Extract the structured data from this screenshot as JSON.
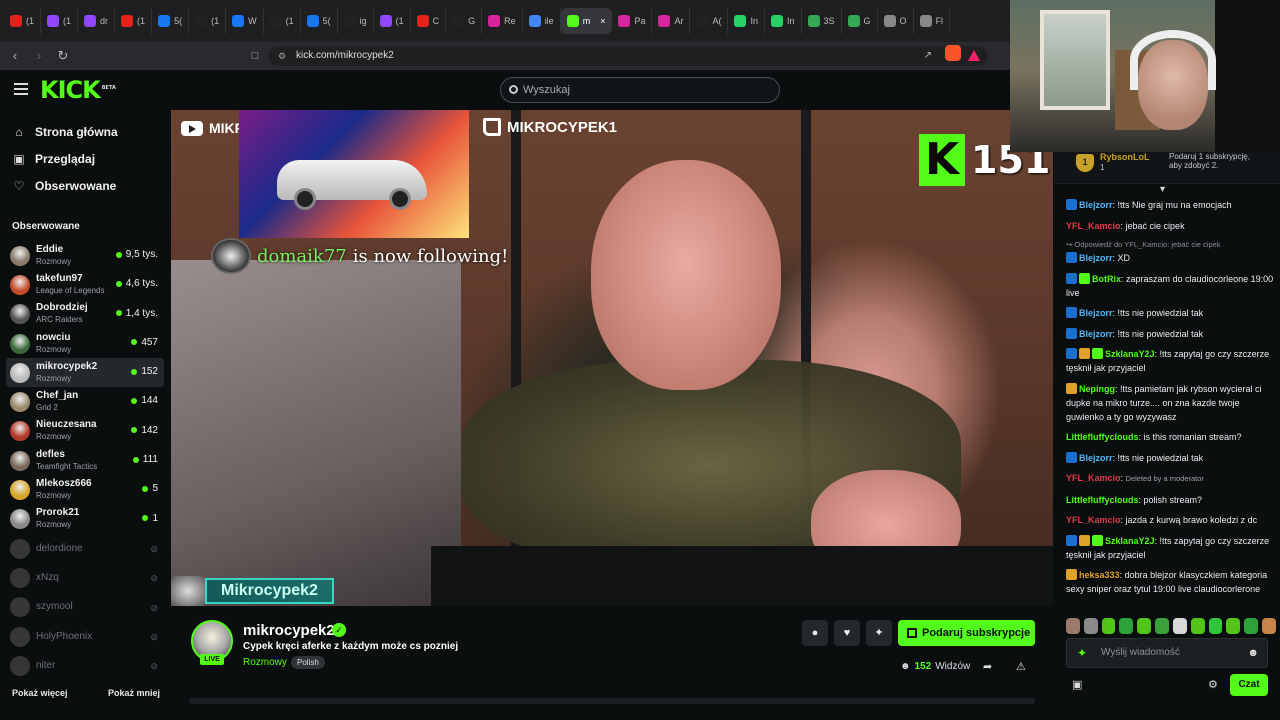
{
  "browser": {
    "tabs": [
      {
        "label": "(1",
        "color": "#e62117"
      },
      {
        "label": "(1",
        "color": "#9146ff"
      },
      {
        "label": "dr",
        "color": "#9146ff"
      },
      {
        "label": "(1",
        "color": "#e62117"
      },
      {
        "label": "5(",
        "color": "#1877f2"
      },
      {
        "label": "(1",
        "color": "#222222"
      },
      {
        "label": "W",
        "color": "#1877f2"
      },
      {
        "label": "(1",
        "color": "#222222"
      },
      {
        "label": "5(",
        "color": "#1877f2"
      },
      {
        "label": "ig",
        "color": "#222222"
      },
      {
        "label": "(1",
        "color": "#9146ff"
      },
      {
        "label": "C",
        "color": "#e62117"
      },
      {
        "label": "G",
        "color": "#222222"
      },
      {
        "label": "Re",
        "color": "#d6249f"
      },
      {
        "label": "ile",
        "color": "#4285f4"
      },
      {
        "label": "m",
        "color": "#53fc18",
        "active": true
      },
      {
        "label": "Pa",
        "color": "#d6249f"
      },
      {
        "label": "Ar",
        "color": "#d6249f"
      },
      {
        "label": "A(",
        "color": "#222222"
      },
      {
        "label": "In",
        "color": "#25d366"
      },
      {
        "label": "In",
        "color": "#25d366"
      },
      {
        "label": "3S",
        "color": "#34a853"
      },
      {
        "label": "G",
        "color": "#34a853"
      },
      {
        "label": "O",
        "color": "#888888"
      },
      {
        "label": "Fl",
        "color": "#888888"
      }
    ],
    "url": "kick.com/mikrocypek2",
    "brave_color": "#fb542b",
    "brave_badge_color": "#ff1f6b"
  },
  "site": {
    "logo": "KICK",
    "logo_sup": "BETA",
    "search_placeholder": "Wyszukaj",
    "accent": "#53fc18"
  },
  "sidebar": {
    "nav": [
      {
        "label": "Strona główna",
        "icon": "home-icon",
        "glyph": "⌂"
      },
      {
        "label": "Przeglądaj",
        "icon": "browse-icon",
        "glyph": "▣"
      },
      {
        "label": "Obserwowane",
        "icon": "heart-icon",
        "glyph": "♡"
      }
    ],
    "following_title": "Obserwowane",
    "channels": [
      {
        "name": "Eddie",
        "category": "Rozmowy",
        "viewers": "9,5 tys.",
        "avatar": "#8a7a6a"
      },
      {
        "name": "takefun97",
        "category": "League of Legends",
        "viewers": "4,6 tys.",
        "avatar": "#c44a2a"
      },
      {
        "name": "Dobrodziej",
        "category": "ARC Raiders",
        "viewers": "1,4 tys.",
        "avatar": "#555555"
      },
      {
        "name": "nowciu",
        "category": "Rozmowy",
        "viewers": "457",
        "avatar": "#3a6a3a"
      },
      {
        "name": "mikrocypek2",
        "category": "Rozmowy",
        "viewers": "152",
        "avatar": "#bbbbbb",
        "selected": true
      },
      {
        "name": "Chef_jan",
        "category": "Grid 2",
        "viewers": "144",
        "avatar": "#9a8a6a"
      },
      {
        "name": "Nieuczesana",
        "category": "Rozmowy",
        "viewers": "142",
        "avatar": "#b03a2a"
      },
      {
        "name": "defles",
        "category": "Teamfight Tactics",
        "viewers": "111",
        "avatar": "#7a6a5a"
      },
      {
        "name": "Mlekosz666",
        "category": "Rozmowy",
        "viewers": "5",
        "avatar": "#d4a52a"
      },
      {
        "name": "Prorok21",
        "category": "Rozmowy",
        "viewers": "1",
        "avatar": "#8a8a8a"
      }
    ],
    "offline": [
      {
        "name": "delordione",
        "avatar": "#777777"
      },
      {
        "name": "xNzq",
        "avatar": "#777777"
      },
      {
        "name": "szymool",
        "avatar": "#777777"
      },
      {
        "name": "HolyPhoenix",
        "avatar": "#777777"
      },
      {
        "name": "niter",
        "avatar": "#777777"
      }
    ],
    "show_more": "Pokaż więcej",
    "show_less": "Pokaż mniej"
  },
  "stream": {
    "yt_label": "MIKR",
    "twitch_label": "MIKROCYPEK1",
    "alert_name": "domaik77",
    "alert_text": "is now following!",
    "counter_value": "151",
    "plate_name": "Mikrocypek2"
  },
  "channel": {
    "name": "mikrocypek2",
    "title": "Cypek kręci aferke z każdym może cs pozniej",
    "category": "Rozmowy",
    "tag": "Polish",
    "live_label": "LIVE",
    "subscribe_label": "Podaruj subskrypcje",
    "viewer_count": "152",
    "viewer_label": "Widzów"
  },
  "chat": {
    "pinned_user": "RybsonLoL",
    "pinned_count": "1",
    "pinned_text": "Podaruj 1 subskrypcję, aby zdobyć 2.",
    "messages": [
      {
        "user": "Blejzorr",
        "color": "#53b6f5",
        "text": "!tts Nie graj mu na emocjach",
        "badges": [
          "#1a6fd0"
        ]
      },
      {
        "user": "YFL_Kamcio",
        "color": "#e0394a",
        "text": "jebać cie cipek",
        "badges": []
      },
      {
        "reply": "Odpowiedź do YFL_Kamcio: jebać cie cipek"
      },
      {
        "user": "Blejzorr",
        "color": "#53b6f5",
        "text": "XD",
        "badges": [
          "#1a6fd0"
        ]
      },
      {
        "user": "BotRix",
        "color": "#53fc18",
        "text": "zapraszam do claudiocorleone 19:00 live",
        "badges": [
          "#1a6fd0",
          "#53fc18"
        ]
      },
      {
        "user": "Blejzorr",
        "color": "#53b6f5",
        "text": "!tts nie powiedzial tak",
        "badges": [
          "#1a6fd0"
        ]
      },
      {
        "user": "Blejzorr",
        "color": "#53b6f5",
        "text": "!tts nie powiedzial tak",
        "badges": [
          "#1a6fd0"
        ]
      },
      {
        "user": "SzklanaY2J",
        "color": "#53fc18",
        "text": "!tts zapytaj go czy szczerze tęsknił jak przyjaciel",
        "badges": [
          "#1a6fd0",
          "#e0a12a",
          "#53fc18"
        ]
      },
      {
        "user": "Nepingg",
        "color": "#53fc18",
        "text": "!tts pamietam jak rybson wycieral ci dupke na mikro turze.... on zna kazde twoje guwienko a ty go wyzywasz",
        "badges": [
          "#e0a12a"
        ]
      },
      {
        "user": "Littlefluffyclouds",
        "color": "#53fc18",
        "text": "is this romanian stream?",
        "badges": []
      },
      {
        "user": "Blejzorr",
        "color": "#53b6f5",
        "text": "!tts nie powiedzial tak",
        "badges": [
          "#1a6fd0"
        ]
      },
      {
        "user": "YFL_Kamcio",
        "color": "#e0394a",
        "deleted": "Deleted by a moderator",
        "badges": []
      },
      {
        "user": "Littlefluffyclouds",
        "color": "#53fc18",
        "text": "polish stream?",
        "badges": []
      },
      {
        "user": "YFL_Kamcio",
        "color": "#e0394a",
        "text": "jazda z kurwą brawo koledzi z dc",
        "badges": []
      },
      {
        "user": "SzklanaY2J",
        "color": "#53fc18",
        "text": "!tts zapytaj go czy szczerze tęsknił jak przyjaciel",
        "badges": [
          "#1a6fd0",
          "#e0a12a",
          "#53fc18"
        ]
      },
      {
        "user": "heksa333",
        "color": "#e0a12a",
        "text": "dobra blejzor klasyczkiem kategoria sexy sniper oraz tytul 19:00 live claudiocorlerone",
        "badges": [
          "#e0a12a"
        ]
      }
    ],
    "emotes": [
      "#9a7a6a",
      "#8a8a8a",
      "#53c418",
      "#2fa13a",
      "#53c418",
      "#3aa13a",
      "#d8d8d8",
      "#53c418",
      "#2fc43a",
      "#53c418",
      "#2fa13a",
      "#c4844a"
    ],
    "input_placeholder": "Wyślij wiadomość",
    "send_label": "Czat"
  }
}
